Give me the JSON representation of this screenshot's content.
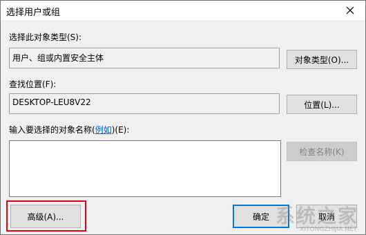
{
  "window": {
    "title": "选择用户或组"
  },
  "object_type": {
    "label": "选择此对象类型(S):",
    "value": "用户、组或内置安全主体",
    "button": "对象类型(O)..."
  },
  "location": {
    "label": "查找位置(F):",
    "value": "DESKTOP-LEU8V22",
    "button": "位置(L)..."
  },
  "names": {
    "label_prefix": "输入要选择的对象名称(",
    "label_link": "例如",
    "label_suffix": ")(E):",
    "value": "",
    "check_button": "检查名称(K)"
  },
  "footer": {
    "advanced_button": "高级(A)...",
    "ok_button": "确定",
    "cancel_button": "取消"
  },
  "watermark": {
    "text": "系统之家",
    "sub": "XITONGZHIJIA.NET"
  },
  "colors": {
    "highlight": "#e60012",
    "link": "#0066cc",
    "focus": "#0078d7"
  }
}
